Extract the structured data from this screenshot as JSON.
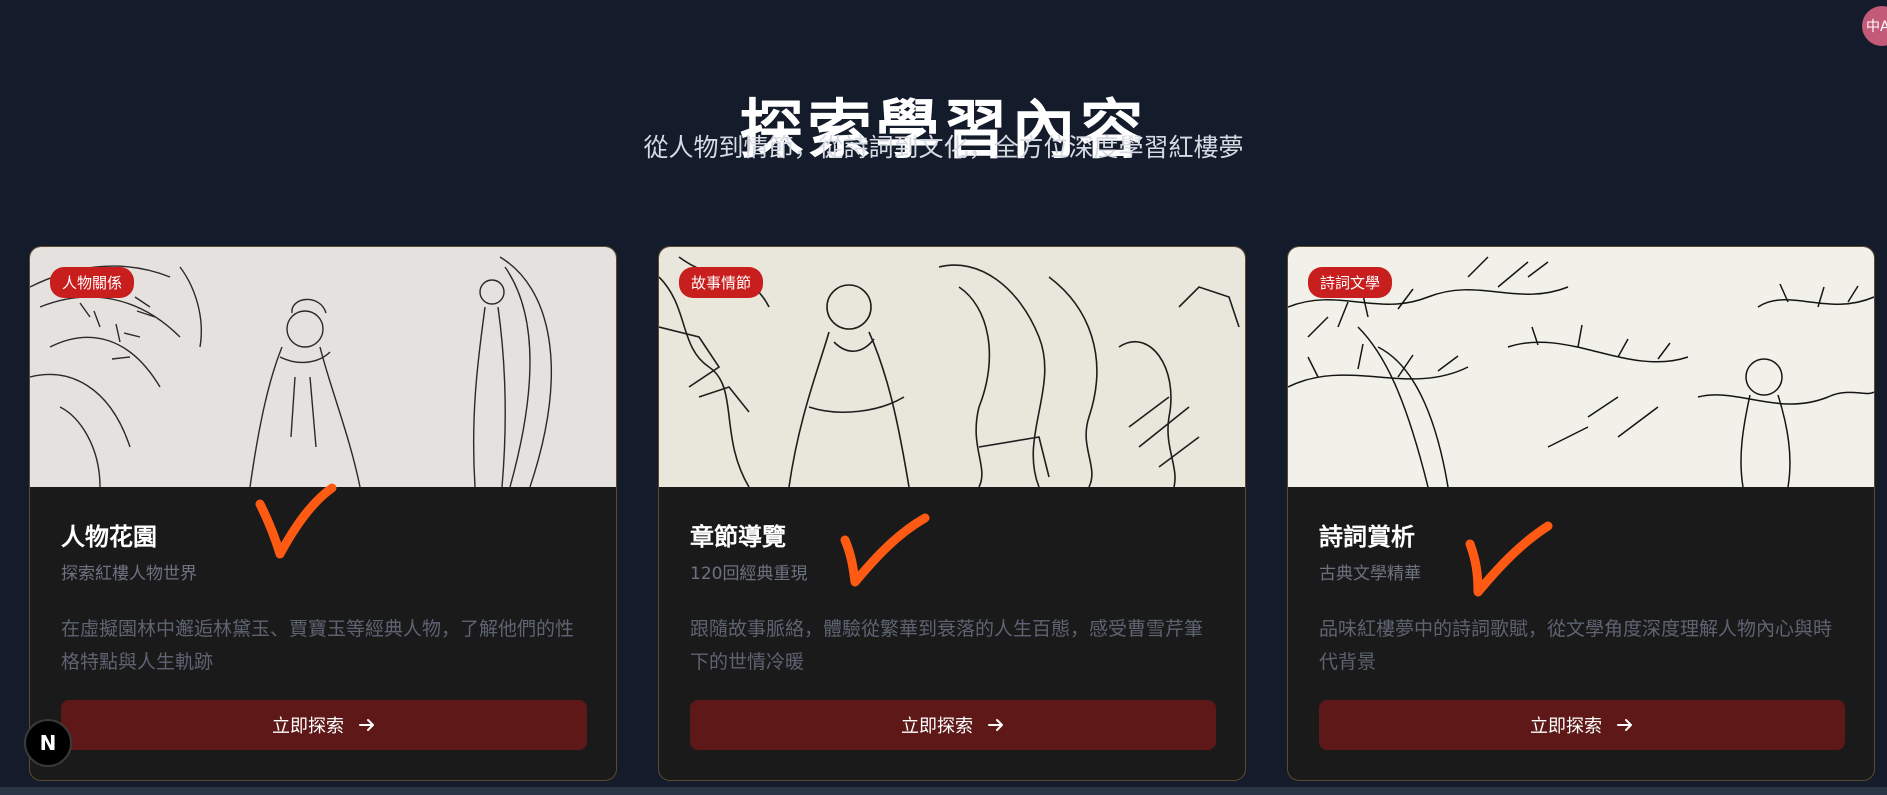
{
  "header": {
    "title": "探索學習內容",
    "subtitle": "從人物到情節，從詩詞到文化，全方位深度學習紅樓夢"
  },
  "cards": [
    {
      "tag": "人物關係",
      "title": "人物花園",
      "subtitle": "探索紅樓人物世界",
      "description": "在虛擬園林中邂逅林黛玉、賈寶玉等經典人物，了解他們的性格特點與人生軌跡",
      "button_label": "立即探索"
    },
    {
      "tag": "故事情節",
      "title": "章節導覽",
      "subtitle": "120回經典重現",
      "description": "跟隨故事脈絡，體驗從繁華到衰落的人生百態，感受曹雪芹筆下的世情冷暖",
      "button_label": "立即探索"
    },
    {
      "tag": "詩詞文學",
      "title": "詩詞賞析",
      "subtitle": "古典文學精華",
      "description": "品味紅樓夢中的詩詞歌賦，從文學角度深度理解人物內心與時代背景",
      "button_label": "立即探索"
    }
  ],
  "icons": {
    "button_arrow": "arrow-right-icon",
    "annotation": "checkmark-icon"
  },
  "dev_badge": {
    "label": "N"
  },
  "avatar": {
    "label": "中A"
  },
  "colors": {
    "background": "#141b2b",
    "card_bg": "#1a1a1a",
    "tag_bg": "#c81e1e",
    "button_bg": "#5e1818",
    "check_mark": "#ff5a14"
  }
}
